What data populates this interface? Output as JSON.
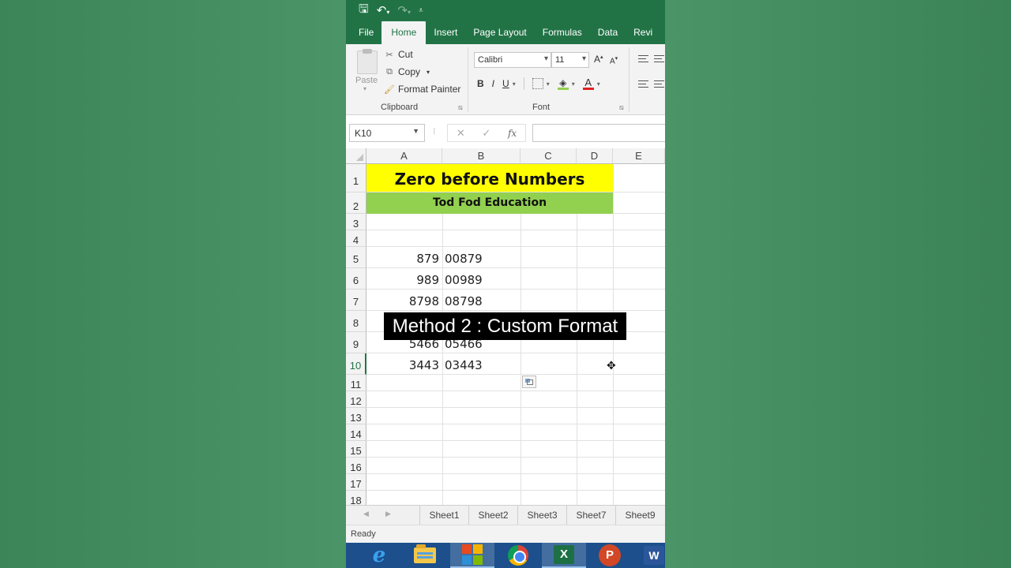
{
  "colors": {
    "excel_green": "#217346",
    "title_fill": "#ffff00",
    "subtitle_fill": "#92d050",
    "taskbar": "#1c4f8c"
  },
  "qat": {
    "icons": [
      "save-icon",
      "undo-icon",
      "redo-icon",
      "customize-qat-icon"
    ]
  },
  "ribbon": {
    "tabs": [
      "File",
      "Home",
      "Insert",
      "Page Layout",
      "Formulas",
      "Data",
      "Revi"
    ],
    "active_tab": "Home",
    "clipboard": {
      "paste_label": "Paste",
      "cut_label": "Cut",
      "copy_label": "Copy",
      "format_painter_label": "Format Painter",
      "group_label": "Clipboard"
    },
    "font": {
      "font_name": "Calibri",
      "font_size": "11",
      "bold": "B",
      "italic": "I",
      "underline": "U",
      "grow": "A",
      "shrink": "A",
      "font_color": "A",
      "group_label": "Font"
    }
  },
  "formula_bar": {
    "name_box": "K10",
    "cancel": "✕",
    "enter": "✓",
    "fx": "fx",
    "value": ""
  },
  "grid": {
    "columns": [
      "A",
      "B",
      "C",
      "D",
      "E"
    ],
    "rows": [
      "1",
      "2",
      "3",
      "4",
      "5",
      "6",
      "7",
      "8",
      "9",
      "10",
      "11",
      "12",
      "13",
      "14",
      "15",
      "16",
      "17",
      "18"
    ],
    "title": "Zero before Numbers",
    "subtitle": "Tod Fod Education",
    "data": [
      {
        "row": "5",
        "a": "879",
        "b": "00879"
      },
      {
        "row": "6",
        "a": "989",
        "b": "00989"
      },
      {
        "row": "7",
        "a": "8798",
        "b": "08798"
      },
      {
        "row": "9",
        "a": "5466",
        "b": "05466"
      },
      {
        "row": "10",
        "a": "3443",
        "b": "03443"
      }
    ],
    "active_cell": "K10"
  },
  "overlay_caption": "Method 2 : Custom Format",
  "sheets": [
    "Sheet1",
    "Sheet2",
    "Sheet3",
    "Sheet7",
    "Sheet9"
  ],
  "status": "Ready",
  "taskbar": {
    "apps": [
      "internet-explorer-icon",
      "file-explorer-icon",
      "store-icon",
      "chrome-icon",
      "excel-icon",
      "powerpoint-icon",
      "word-icon"
    ],
    "excel_letter": "X",
    "powerpoint_letter": "P",
    "word_letter": "W",
    "ie_letter": "e"
  }
}
